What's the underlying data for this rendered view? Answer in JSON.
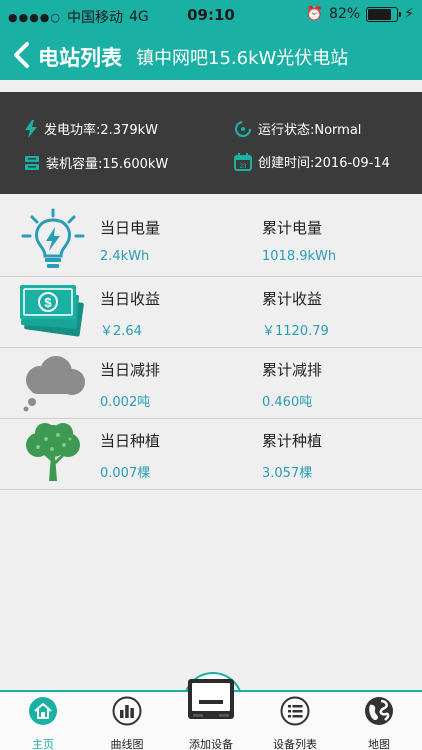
{
  "status_bar": {
    "carrier": "中国移动",
    "network": "4G",
    "time": "09:10",
    "battery": "82%",
    "battery_level": 0.82
  },
  "nav": {
    "title": "电站列表",
    "station": "镇中网吧15.6kW光伏电站"
  },
  "info": {
    "power": "发电功率:2.379kW",
    "status": "运行状态:Normal",
    "capacity": "装机容量:15.600kW",
    "created": "创建时间:2016-09-14"
  },
  "stats": [
    {
      "icon": "lightbulb-icon",
      "label1": "当日电量",
      "value1": "2.4kWh",
      "label2": "累计电量",
      "value2": "1018.9kWh"
    },
    {
      "icon": "money-icon",
      "label1": "当日收益",
      "value1": "￥2.64",
      "label2": "累计收益",
      "value2": "￥1120.79"
    },
    {
      "icon": "cloud-icon",
      "label1": "当日减排",
      "value1": "0.002吨",
      "label2": "累计减排",
      "value2": "0.460吨"
    },
    {
      "icon": "tree-icon",
      "label1": "当日种植",
      "value1": "0.007棵",
      "label2": "累计种植",
      "value2": "3.057棵"
    }
  ],
  "tabs": [
    {
      "label": "主页",
      "icon": "home-icon",
      "active": true
    },
    {
      "label": "曲线图",
      "icon": "bar-chart-icon"
    },
    {
      "label": "添加设备",
      "icon": "add-device-icon"
    },
    {
      "label": "设备列表",
      "icon": "list-icon"
    },
    {
      "label": "地图",
      "icon": "globe-icon"
    }
  ],
  "colors": {
    "accent": "#1ab0a4",
    "info_bg": "#3b3b3b",
    "value": "#2a9db6"
  }
}
